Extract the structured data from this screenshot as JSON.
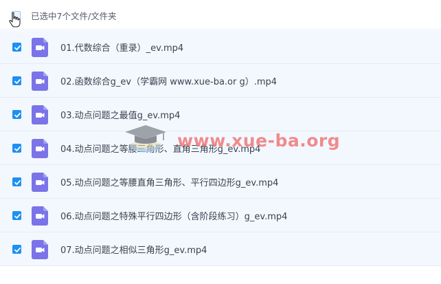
{
  "header": {
    "selection_text": "已选中7个文件/文件夹",
    "all_checked": true
  },
  "files": [
    {
      "name": "01.代数综合（重录）_ev.mp4",
      "checked": true,
      "icon": "video-file-icon"
    },
    {
      "name": "02.函数综合g_ev（学霸网 www.xue-ba.or g）.mp4",
      "checked": true,
      "icon": "video-file-icon"
    },
    {
      "name": "03.动点问题之最值g_ev.mp4",
      "checked": true,
      "icon": "video-file-icon"
    },
    {
      "name": "04.动点问题之等腰三角形、直角三角形g_ev.mp4",
      "checked": true,
      "icon": "video-file-icon"
    },
    {
      "name": "05.动点问题之等腰直角三角形、平行四边形g_ev.mp4",
      "checked": true,
      "icon": "video-file-icon"
    },
    {
      "name": "06.动点问题之特殊平行四边形（含阶段练习）g_ev.mp4",
      "checked": true,
      "icon": "video-file-icon"
    },
    {
      "name": "07.动点问题之相似三角形g_ev.mp4",
      "checked": true,
      "icon": "video-file-icon"
    }
  ],
  "watermark": {
    "text": "www.xue-ba.org",
    "icon": "graduation-cap-icon"
  },
  "colors": {
    "accent": "#1e90f2",
    "file_icon": "#7b73e8",
    "row_bg": "#f3f8fe",
    "watermark": "#ef6d6d"
  }
}
